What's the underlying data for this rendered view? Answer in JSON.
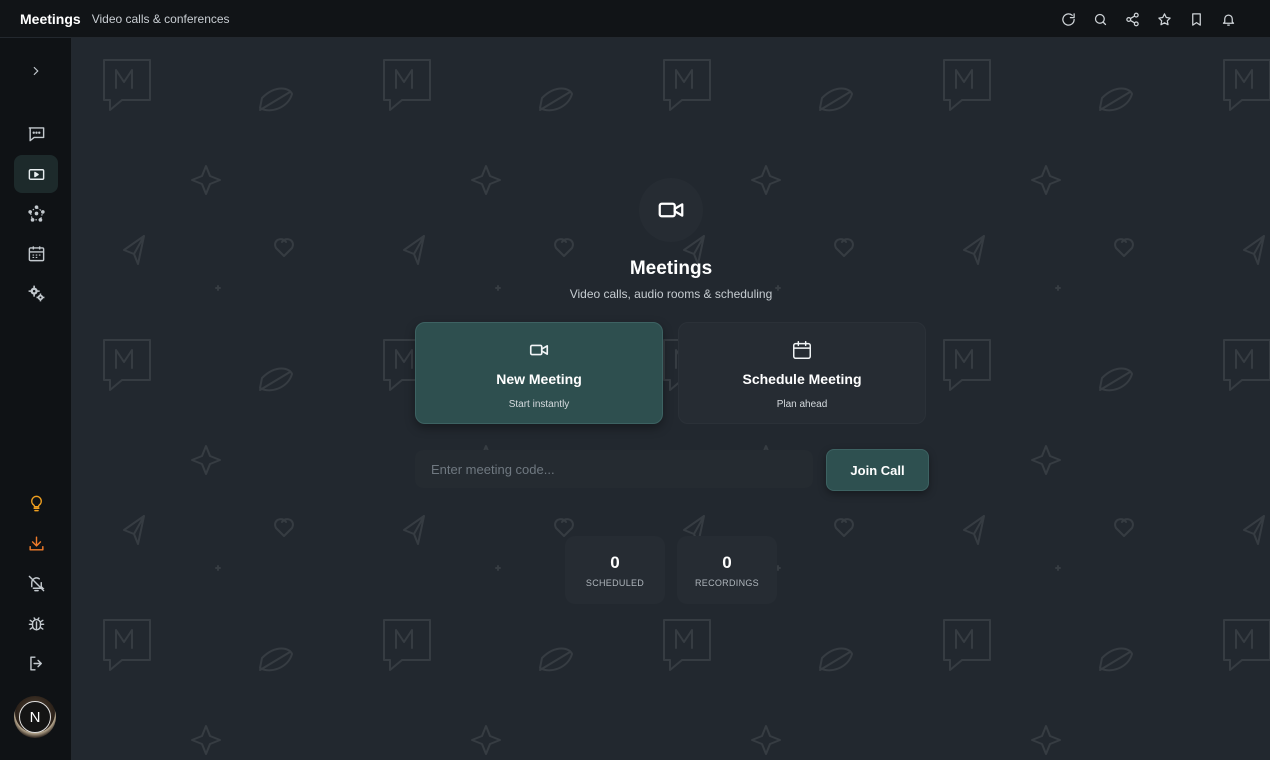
{
  "header": {
    "title": "Meetings",
    "subtitle": "Video calls & conferences",
    "actions": [
      {
        "name": "refresh-icon"
      },
      {
        "name": "search-icon"
      },
      {
        "name": "share-icon"
      },
      {
        "name": "star-icon"
      },
      {
        "name": "bookmark-icon"
      },
      {
        "name": "bell-icon"
      }
    ]
  },
  "sidebar": {
    "expand_icon": "chevron-right-icon",
    "items": [
      {
        "name": "chat-icon",
        "active": false
      },
      {
        "name": "video-icon",
        "active": true
      },
      {
        "name": "network-icon",
        "active": false
      },
      {
        "name": "calendar-icon",
        "active": false
      },
      {
        "name": "settings-icon",
        "active": false
      }
    ],
    "bottom_items": [
      {
        "name": "lightbulb-icon",
        "color": "#f0a020"
      },
      {
        "name": "download-icon",
        "color": "#f07c2a"
      },
      {
        "name": "bell-off-icon"
      },
      {
        "name": "bug-icon"
      },
      {
        "name": "logout-icon"
      }
    ],
    "avatar_letter": "N"
  },
  "main": {
    "hero_icon": "video-camera-icon",
    "title": "Meetings",
    "subtitle": "Video calls, audio rooms & scheduling",
    "cards": {
      "new_meeting": {
        "title": "New Meeting",
        "subtitle": "Start instantly",
        "icon": "video-camera-icon"
      },
      "schedule_meeting": {
        "title": "Schedule Meeting",
        "subtitle": "Plan ahead",
        "icon": "calendar-icon"
      }
    },
    "join": {
      "placeholder": "Enter meeting code...",
      "value": "",
      "button_label": "Join Call"
    },
    "stats": {
      "scheduled": {
        "value": "0",
        "label": "SCHEDULED"
      },
      "recordings": {
        "value": "0",
        "label": "RECORDINGS"
      }
    }
  },
  "colors": {
    "accent_teal": "#2e4f4f",
    "lightbulb": "#f0a020",
    "download": "#f07c2a",
    "background": "#22282f",
    "sidebar": "#0f1215"
  }
}
